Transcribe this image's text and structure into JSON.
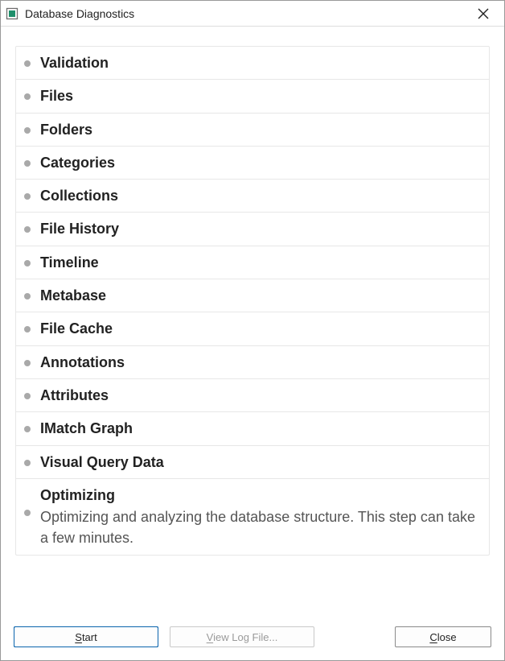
{
  "window": {
    "title": "Database Diagnostics"
  },
  "items": [
    {
      "name": "Validation"
    },
    {
      "name": "Files"
    },
    {
      "name": "Folders"
    },
    {
      "name": "Categories"
    },
    {
      "name": "Collections"
    },
    {
      "name": "File History"
    },
    {
      "name": "Timeline"
    },
    {
      "name": "Metabase"
    },
    {
      "name": "File Cache"
    },
    {
      "name": "Annotations"
    },
    {
      "name": "Attributes"
    },
    {
      "name": "IMatch Graph"
    },
    {
      "name": "Visual Query Data"
    },
    {
      "name": "Optimizing",
      "desc": "Optimizing and analyzing the database structure. This step can take a few minutes."
    }
  ],
  "footer": {
    "start_label": "Start",
    "viewlog_label": "View Log File...",
    "close_label": "Close",
    "start_accel": "S",
    "viewlog_accel": "V",
    "close_accel": "C"
  }
}
